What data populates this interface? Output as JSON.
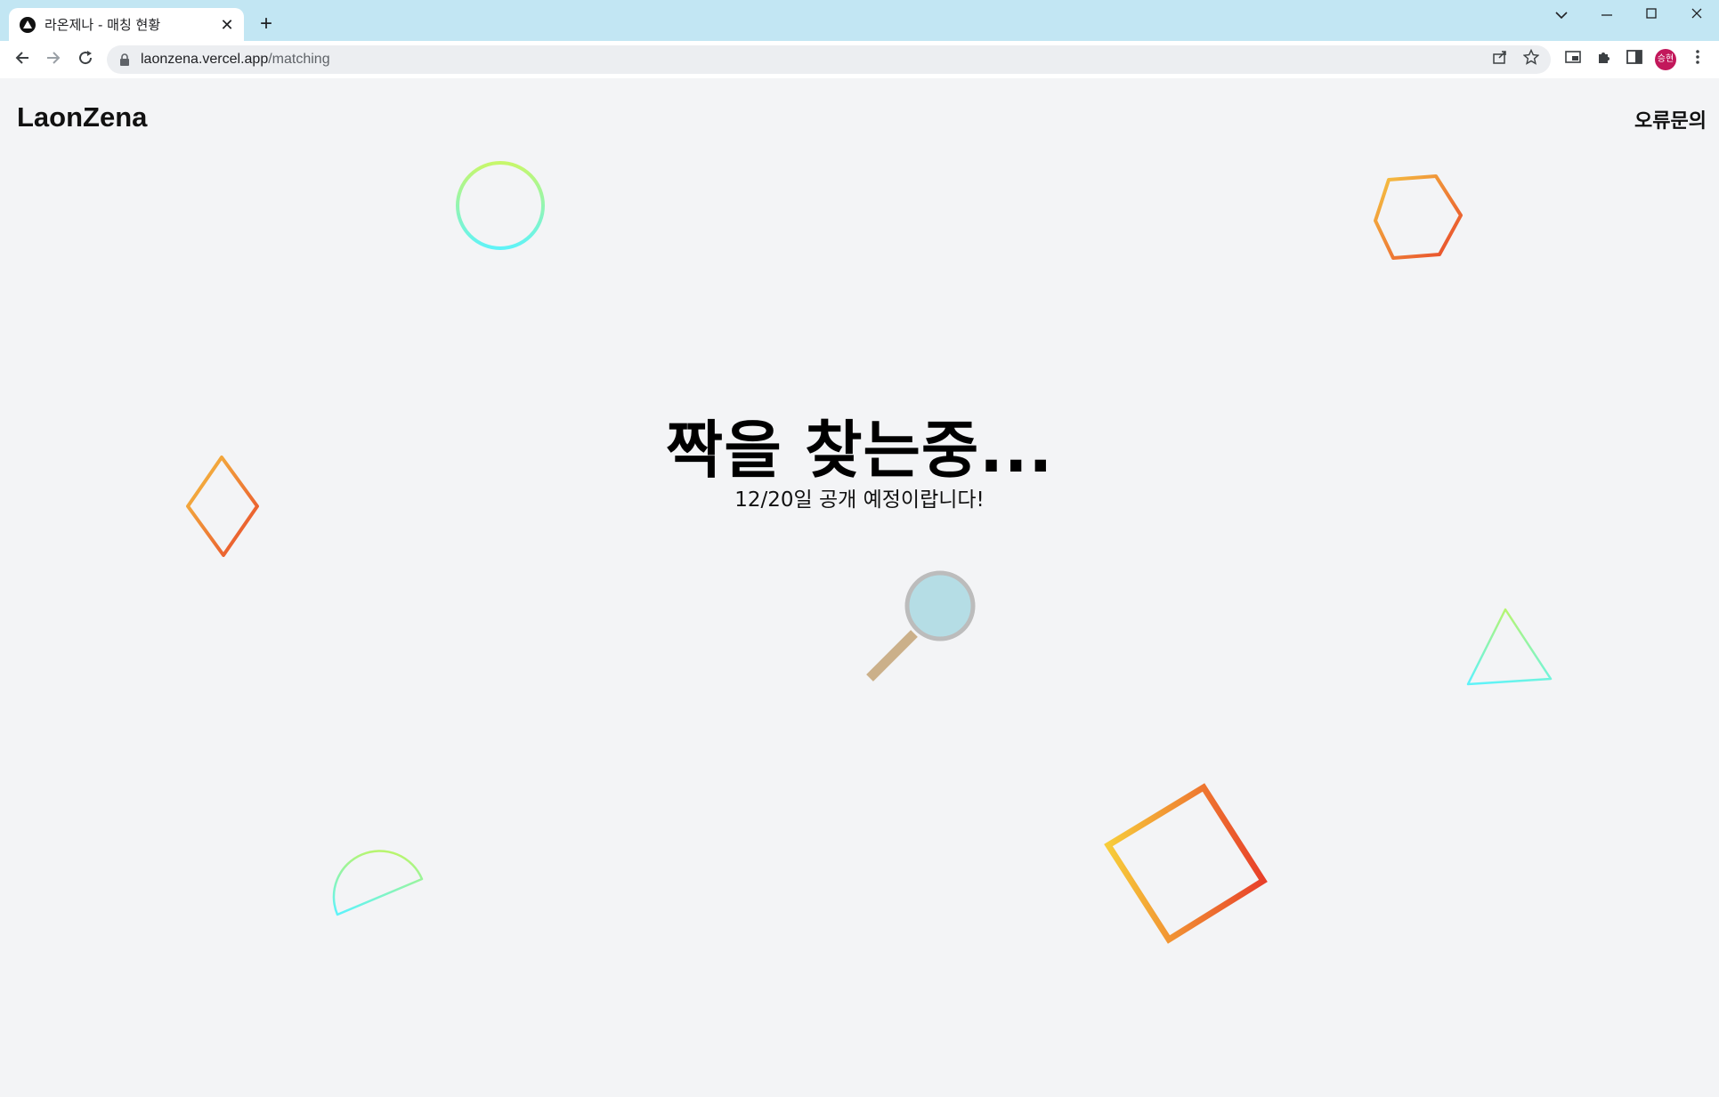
{
  "browser": {
    "tab_title": "라온제나 - 매칭 현황",
    "tab_close": "✕",
    "new_tab": "+",
    "url_host": "laonzena.vercel.app",
    "url_path": "/matching",
    "avatar_text": "승현",
    "window_controls": [
      "chevron-down-icon",
      "minimize-icon",
      "maximize-icon",
      "close-icon"
    ]
  },
  "header": {
    "logo": "LaonZena",
    "report_link": "오류문의"
  },
  "main": {
    "heading": "짝을 찾는중...",
    "subheading": "12/20일 공개 예정이랍니다!"
  },
  "decorations": [
    "circle-shape",
    "hexagon-shape",
    "diamond-shape",
    "triangle-shape",
    "half-circle-shape",
    "square-shape",
    "magnifier-icon"
  ],
  "colors": {
    "page_bg": "#f3f4f6",
    "titlebar_bg": "#c2e6f3",
    "warm_gradient": [
      "#f5c542",
      "#e8452b"
    ],
    "cool_gradient": [
      "#c7f76a",
      "#5ff3f8"
    ],
    "magnifier_lens": "#b5dde5",
    "magnifier_handle": "#cbb08a"
  }
}
